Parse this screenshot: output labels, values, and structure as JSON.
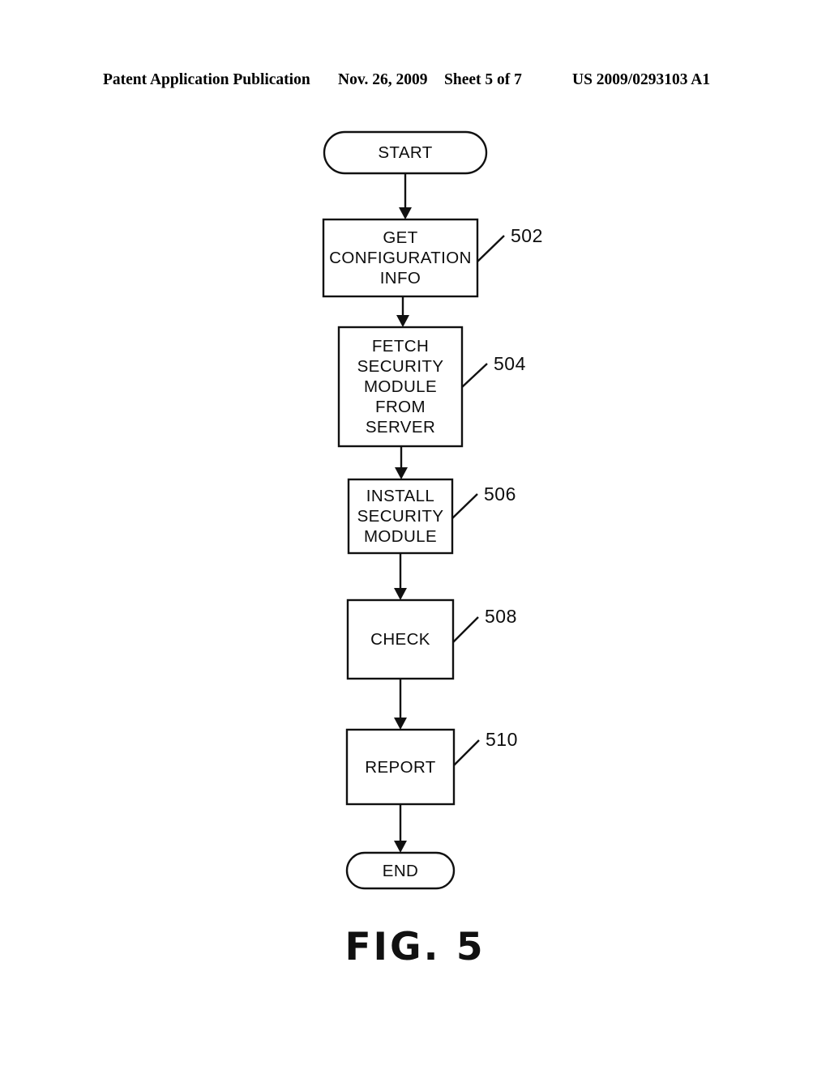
{
  "header": {
    "publication": "Patent Application Publication",
    "date": "Nov. 26, 2009",
    "sheet": "Sheet 5 of 7",
    "document_number": "US 2009/0293103 A1"
  },
  "figure": {
    "caption": "FIG. 5",
    "colors": {
      "stroke": "#111111",
      "background": "#ffffff",
      "text": "#0d0d0d"
    },
    "nodes": [
      {
        "id": "start",
        "shape": "stadium",
        "lines": [
          "START"
        ],
        "ref": null
      },
      {
        "id": "get-configuration-info",
        "shape": "rect",
        "lines": [
          "GET",
          "CONFIGURATION",
          "INFO"
        ],
        "ref": "502"
      },
      {
        "id": "fetch-security-module-from-server",
        "shape": "rect",
        "lines": [
          "FETCH",
          "SECURITY",
          "MODULE",
          "FROM",
          "SERVER"
        ],
        "ref": "504"
      },
      {
        "id": "install-security-module",
        "shape": "rect",
        "lines": [
          "INSTALL",
          "SECURITY",
          "MODULE"
        ],
        "ref": "506"
      },
      {
        "id": "check",
        "shape": "rect",
        "lines": [
          "CHECK"
        ],
        "ref": "508"
      },
      {
        "id": "report",
        "shape": "rect",
        "lines": [
          "REPORT"
        ],
        "ref": "510"
      },
      {
        "id": "end",
        "shape": "stadium",
        "lines": [
          "END"
        ],
        "ref": null
      }
    ],
    "connectors": [
      {
        "from": "start",
        "to": "get-configuration-info",
        "arrow": "down"
      },
      {
        "from": "get-configuration-info",
        "to": "fetch-security-module-from-server",
        "arrow": "down"
      },
      {
        "from": "fetch-security-module-from-server",
        "to": "install-security-module",
        "arrow": "down"
      },
      {
        "from": "install-security-module",
        "to": "check",
        "arrow": "down"
      },
      {
        "from": "check",
        "to": "report",
        "arrow": "down"
      },
      {
        "from": "report",
        "to": "end",
        "arrow": "down"
      }
    ]
  }
}
